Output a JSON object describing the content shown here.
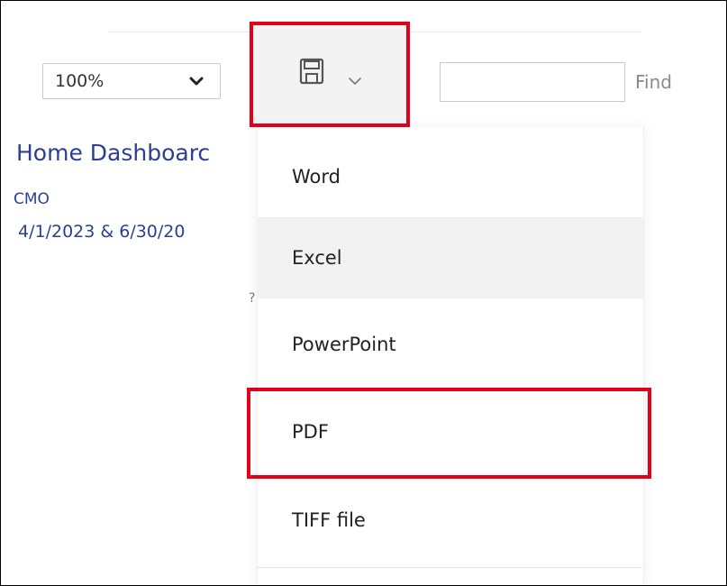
{
  "toolbar": {
    "zoom": {
      "selected": "100%"
    },
    "export": {
      "icon": "save-icon",
      "chevron": "chevron-down-icon"
    },
    "find": {
      "value": "",
      "label": "Find"
    }
  },
  "report": {
    "title": "Home Dashboarc",
    "role": "CMO",
    "dates": "4/1/2023 & 6/30/20",
    "stray": "?"
  },
  "export_menu": {
    "items": [
      {
        "label": "Word"
      },
      {
        "label": "Excel"
      },
      {
        "label": "PowerPoint"
      },
      {
        "label": "PDF"
      },
      {
        "label": "TIFF file"
      }
    ]
  },
  "colors": {
    "highlight": "#e3001b",
    "report_text": "#2b3f93",
    "hover_bg": "#f2f2f2"
  }
}
